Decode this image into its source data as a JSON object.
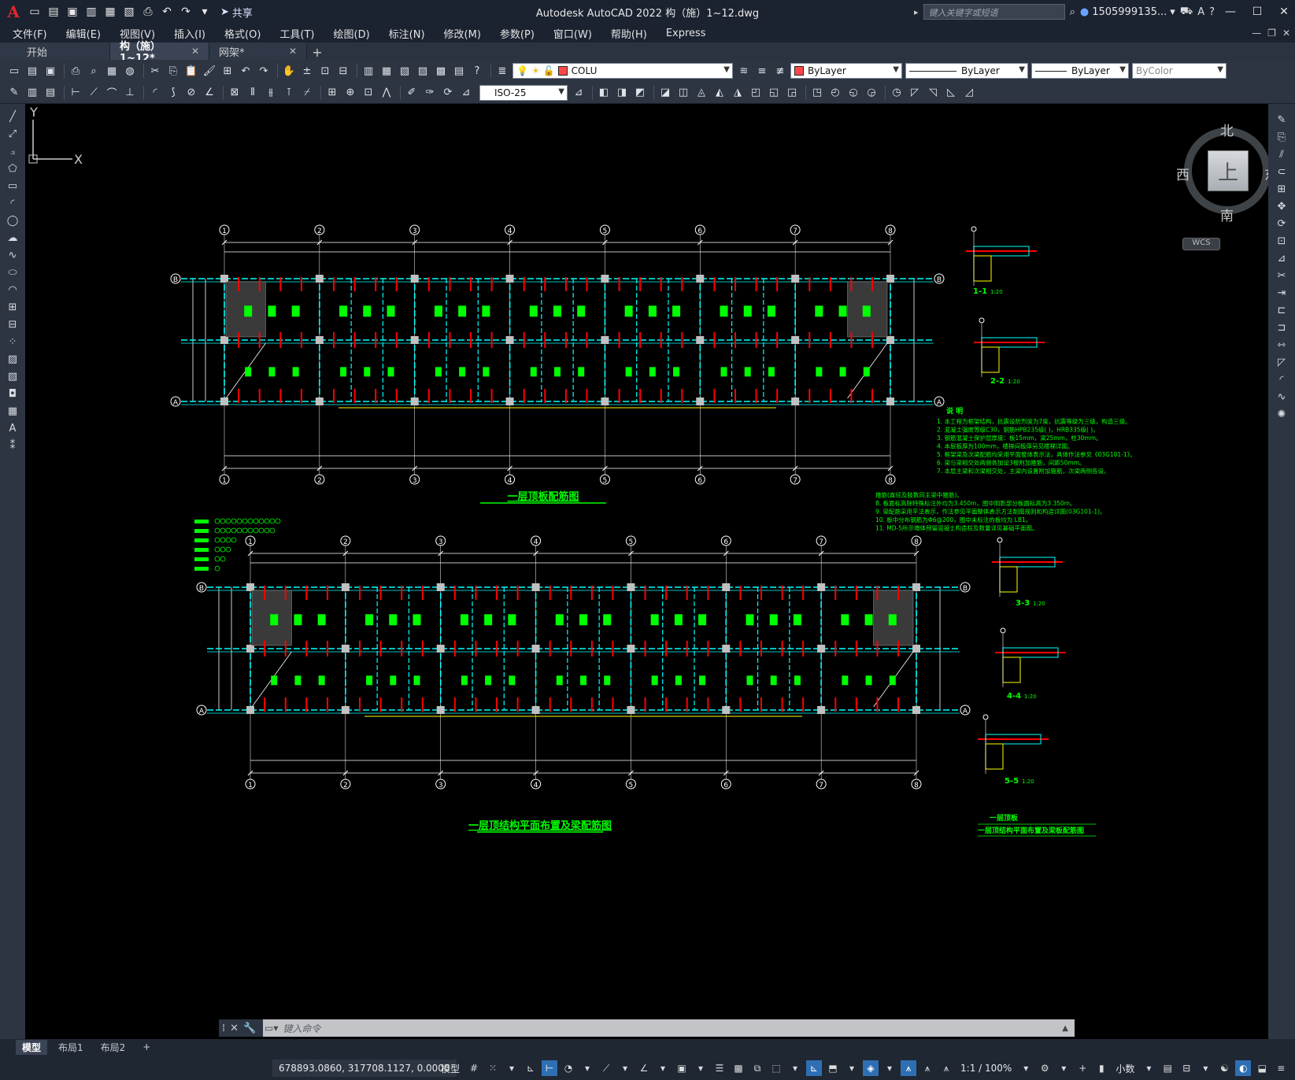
{
  "app": {
    "logo": "A",
    "title": "Autodesk AutoCAD 2022    构（施）1~12.dwg",
    "share_label": "共享",
    "search_placeholder": "键入关键字或短语",
    "user": "1505999135...",
    "colors": {
      "accent": "#2e6fb4",
      "canvas": "#000000",
      "lime": "#00ff00",
      "cyan": "#00ffff",
      "red": "#ff0000",
      "yellow": "#ffff00"
    }
  },
  "menu": [
    "文件(F)",
    "编辑(E)",
    "视图(V)",
    "插入(I)",
    "格式(O)",
    "工具(T)",
    "绘图(D)",
    "标注(N)",
    "修改(M)",
    "参数(P)",
    "窗口(W)",
    "帮助(H)",
    "Express"
  ],
  "tabs": [
    {
      "label": "开始"
    },
    {
      "label": "构（施）1~12*"
    },
    {
      "label": "网架*"
    }
  ],
  "toolbar": {
    "layer": "COLU",
    "color": "ByLayer",
    "linetype": "ByLayer",
    "lineweight": "ByLayer",
    "plotstyle": "ByColor",
    "dimstyle": "ISO-25"
  },
  "viewcube": {
    "north": "北",
    "south": "南",
    "east": "东",
    "west": "西",
    "top": "上",
    "wcs": "WCS"
  },
  "drawing": {
    "axis_labels": [
      "1",
      "2",
      "3",
      "4",
      "5",
      "6",
      "7",
      "8"
    ],
    "row_labels": [
      "B",
      "A"
    ],
    "plan1_title": "一层顶板配筋图",
    "plan2_title": "一层顶结构平面布置及梁配筋图",
    "sections": [
      "1-1",
      "2-2",
      "3-3",
      "4-4",
      "5-5"
    ],
    "section_scale": "1:20",
    "notes_heading": "说  明",
    "notes": [
      "1. 本工程为框架结构，抗震设防烈度为7度，抗震等级为三级，构造三级。",
      "2. 混凝土强度等级C30，钢筋HPB235级( )，HRB335级( )。",
      "3. 钢筋混凝土保护层厚度：板15mm，梁25mm，柱30mm。",
      "4. 本层板厚为100mm，楼梯间板厚另见楼梯详图。",
      "5. 框架梁及次梁配筋均采用平面整体表示法，具体作法参见《03G101-1》。",
      "6. 梁与梁相交处两侧各加设3根附加箍筋，间距50mm。",
      "7. 本层主梁和次梁相交处，主梁内设置附加箍筋，次梁两侧各设。",
      "   箍筋(直径及肢数同主梁中箍筋)。",
      "8. 板面标高除特殊标注外均为3.450m，图中阴影部分板面标高为3.350m。",
      "9. 梁配筋采用平法表示，作法参见平面整体表示方法制图规则和构造详图(03G101-1)。",
      "10. 板中分布钢筋为Φ6@200，图中未标注的板均为 LB1。",
      "11. MD-5所示墙体预留混凝土构造柱及数量详见基础平面图。"
    ],
    "titleblock": [
      "一层顶板",
      "一层顶结构平面布置及梁板配筋图"
    ]
  },
  "command": {
    "placeholder": "键入命令"
  },
  "layout_tabs": [
    "模型",
    "布局1",
    "布局2"
  ],
  "status": {
    "coords": "678893.0860, 317708.1127, 0.0000",
    "model": "模型",
    "annoscale": "1:1 / 100%",
    "units": "小数"
  }
}
